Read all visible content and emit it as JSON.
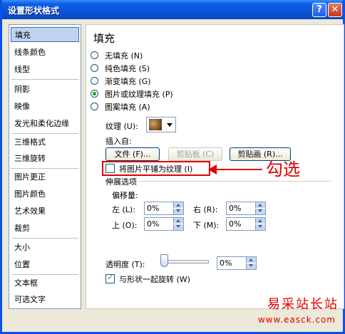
{
  "window": {
    "title": "设置形状格式",
    "help_label": "?",
    "close_label": "✕"
  },
  "categories": [
    "填充",
    "线条颜色",
    "线型",
    "阴影",
    "映像",
    "发光和柔化边缘",
    "三维格式",
    "三维旋转",
    "图片更正",
    "图片颜色",
    "艺术效果",
    "裁剪",
    "大小",
    "位置",
    "文本框",
    "可选文字"
  ],
  "selected_category": "填充",
  "fill": {
    "heading": "填充",
    "options": [
      {
        "label": "无填充 (N)",
        "checked": false
      },
      {
        "label": "纯色填充 (S)",
        "checked": false
      },
      {
        "label": "渐变填充 (G)",
        "checked": false
      },
      {
        "label": "图片或纹理填充 (P)",
        "checked": true
      },
      {
        "label": "图案填充 (A)",
        "checked": false
      }
    ],
    "texture_label": "纹理 (U):",
    "insert_from_label": "插入自:",
    "file_button": "文件 (F)...",
    "clipboard_button": "剪贴板 (C)",
    "clipart_button": "剪贴画 (R)...",
    "tile_checkbox": "将图片平铺为纹理 (I)",
    "stretch_group": "伸展选项",
    "offsets_label": "偏移量:",
    "left_label": "左 (L):",
    "right_label": "右 (R):",
    "top_label": "上 (O):",
    "bottom_label": "下 (M):",
    "left_value": "0%",
    "right_value": "0%",
    "top_value": "0%",
    "bottom_value": "0%",
    "transparency_label": "透明度 (T):",
    "transparency_value": "0%",
    "rotate_with_shape": "与形状一起旋转 (W)",
    "rotate_checked": true
  },
  "annotation": {
    "text": "勾选"
  },
  "watermark": {
    "line1": "易采站长站",
    "line2": "www.easck.com"
  },
  "colors": {
    "title_bar": "#0b55d8",
    "selection": "#c1d2ee",
    "annotation": "#e00000"
  }
}
